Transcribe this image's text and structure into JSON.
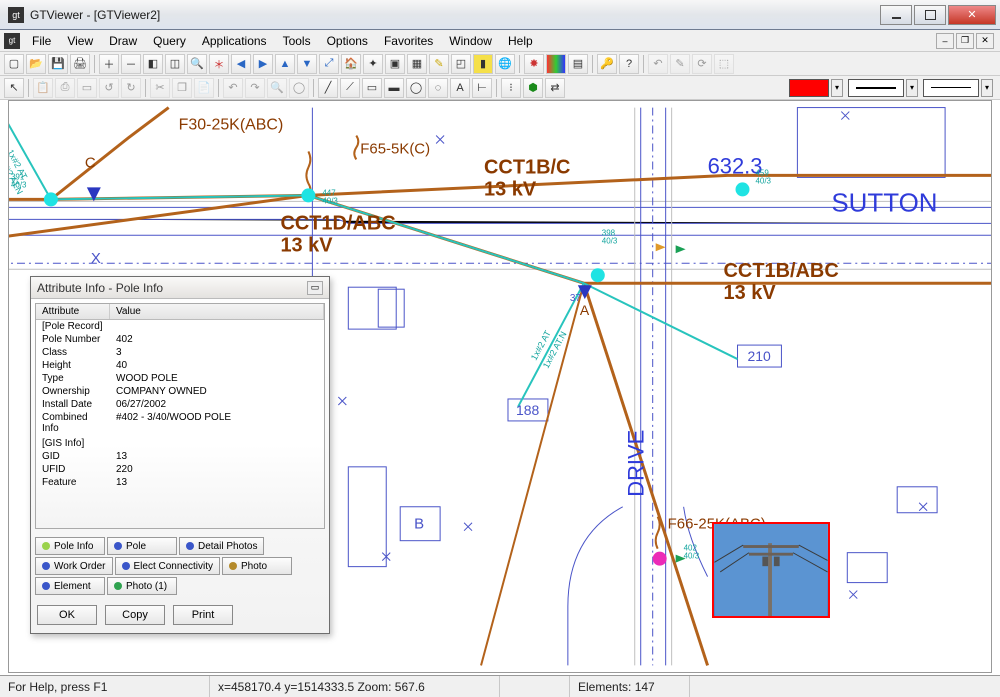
{
  "window": {
    "title": "GTViewer  -  [GTViewer2]"
  },
  "menu": {
    "items": [
      "File",
      "View",
      "Draw",
      "Query",
      "Applications",
      "Tools",
      "Options",
      "Favorites",
      "Window",
      "Help"
    ]
  },
  "status": {
    "help": "For Help, press F1",
    "coords": "x=458170.4 y=1514333.5  Zoom: 567.6",
    "elements": "Elements: 147"
  },
  "map": {
    "labels": {
      "f30": "F30-25K(ABC)",
      "f65": "F65-5K(C)",
      "f66": "F66-25K(ABC)",
      "cct1bc": "CCT1B/C",
      "cct1babc": "CCT1B/ABC",
      "cct1dabc": "CCT1D/ABC",
      "kv13a": "13 kV",
      "kv13b": "13 kV",
      "kv13c": "13 kV",
      "sutton": "SUTTON",
      "drive": "DRIVE",
      "num6323": "632.3",
      "letterA": "A",
      "letterB": "B",
      "letterC": "C",
      "letterX": "X",
      "n188": "188",
      "n210": "210",
      "n37": "37",
      "t391": "391",
      "t403": "40/3",
      "t447": "447",
      "t403b": "40/3",
      "t398": "398",
      "t403c": "40/3",
      "t459": "459",
      "t403d": "40/3",
      "t402": "402",
      "t403e": "40/3",
      "guy1": "1x#2 AT",
      "guy1n": "1x#2 AT.N",
      "guy2": "1x#2 AT",
      "guy2n": "1x#2 AT.N"
    }
  },
  "attr_panel": {
    "title": "Attribute Info - Pole Info",
    "headers": {
      "c1": "Attribute",
      "c2": "Value"
    },
    "rows": [
      {
        "a": "[Pole Record]",
        "v": ""
      },
      {
        "a": "Pole Number",
        "v": "402"
      },
      {
        "a": "Class",
        "v": "3"
      },
      {
        "a": "Height",
        "v": "40"
      },
      {
        "a": "Type",
        "v": "WOOD POLE"
      },
      {
        "a": "Ownership",
        "v": "COMPANY OWNED"
      },
      {
        "a": "Install Date",
        "v": "06/27/2002"
      },
      {
        "a": "Combined Info",
        "v": "#402 - 3/40/WOOD POLE"
      },
      {
        "a": "",
        "v": ""
      },
      {
        "a": "[GIS Info]",
        "v": ""
      },
      {
        "a": "GID",
        "v": "13"
      },
      {
        "a": "UFID",
        "v": "220"
      },
      {
        "a": "Feature",
        "v": "13"
      }
    ],
    "tabs": [
      {
        "label": "Pole Info",
        "color": "#9ad24b"
      },
      {
        "label": "Pole",
        "color": "#3a56c9"
      },
      {
        "label": "Detail Photos",
        "color": "#3a56c9"
      },
      {
        "label": "Work Order",
        "color": "#3a56c9"
      },
      {
        "label": "Elect Connectivity",
        "color": "#3a56c9"
      },
      {
        "label": "Photo",
        "color": "#b48a2a"
      },
      {
        "label": "Element",
        "color": "#3a56c9"
      },
      {
        "label": "Photo (1)",
        "color": "#2fa24f"
      }
    ],
    "buttons": {
      "ok": "OK",
      "copy": "Copy",
      "print": "Print"
    }
  }
}
